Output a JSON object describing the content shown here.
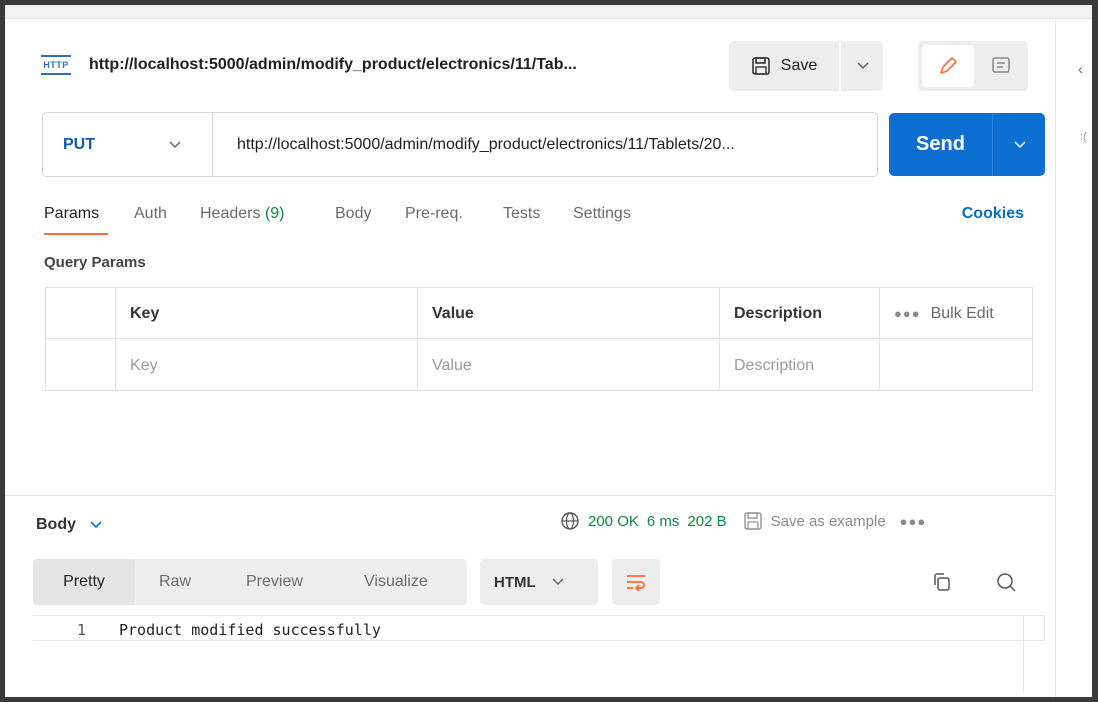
{
  "request": {
    "title": "http://localhost:5000/admin/modify_product/electronics/11/Tab...",
    "method": "PUT",
    "url": "http://localhost:5000/admin/modify_product/electronics/11/Tablets/20..."
  },
  "toolbar": {
    "save_label": "Save",
    "send_label": "Send",
    "http_badge": "HTTP"
  },
  "tabs": [
    {
      "label": "Params",
      "active": true
    },
    {
      "label": "Auth"
    },
    {
      "label": "Headers",
      "count": "(9)"
    },
    {
      "label": "Body"
    },
    {
      "label": "Pre-req."
    },
    {
      "label": "Tests"
    },
    {
      "label": "Settings"
    }
  ],
  "cookies_label": "Cookies",
  "query_params": {
    "label": "Query Params",
    "headers": [
      "Key",
      "Value",
      "Description"
    ],
    "bulk_edit": "Bulk Edit",
    "placeholders": [
      "Key",
      "Value",
      "Description"
    ]
  },
  "response": {
    "body_label": "Body",
    "status": "200 OK",
    "time": "6 ms",
    "size": "202 B",
    "save_example": "Save as example",
    "view_tabs": [
      "Pretty",
      "Raw",
      "Preview",
      "Visualize"
    ],
    "format": "HTML",
    "lines": [
      {
        "num": "1",
        "text": "Product modified successfully"
      }
    ]
  },
  "colors": {
    "accent_orange": "#ff6c37",
    "send_blue": "#0d6fd1",
    "method_blue": "#0a5cb3",
    "status_green": "#0b8a3e"
  }
}
